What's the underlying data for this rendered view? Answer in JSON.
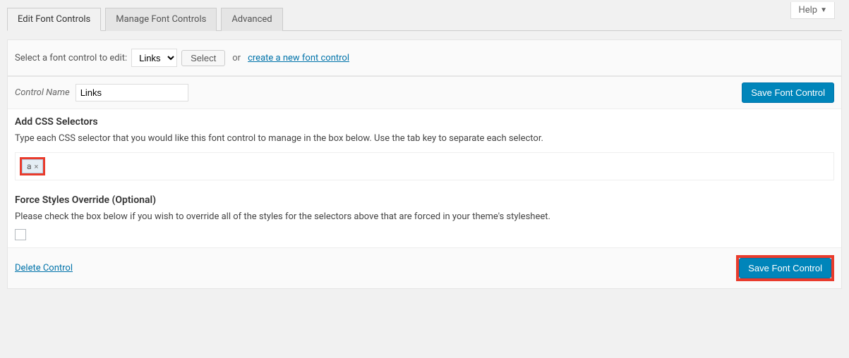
{
  "help": {
    "label": "Help"
  },
  "tabs": {
    "edit": "Edit Font Controls",
    "manage": "Manage Font Controls",
    "advanced": "Advanced"
  },
  "selectorBar": {
    "label": "Select a font control to edit:",
    "selected": "Links",
    "selectBtn": "Select",
    "orText": "or",
    "createLink": "create a new font control"
  },
  "controlName": {
    "label": "Control Name",
    "value": "Links"
  },
  "saveBtn": "Save Font Control",
  "addSelectors": {
    "heading": "Add CSS Selectors",
    "desc": "Type each CSS selector that you would like this font control to manage in the box below. Use the tab key to separate each selector.",
    "chip": "a"
  },
  "forceOverride": {
    "heading": "Force Styles Override (Optional)",
    "desc": "Please check the box below if you wish to override all of the styles for the selectors above that are forced in your theme's stylesheet."
  },
  "footer": {
    "deleteLink": "Delete Control",
    "saveBtn": "Save Font Control"
  }
}
